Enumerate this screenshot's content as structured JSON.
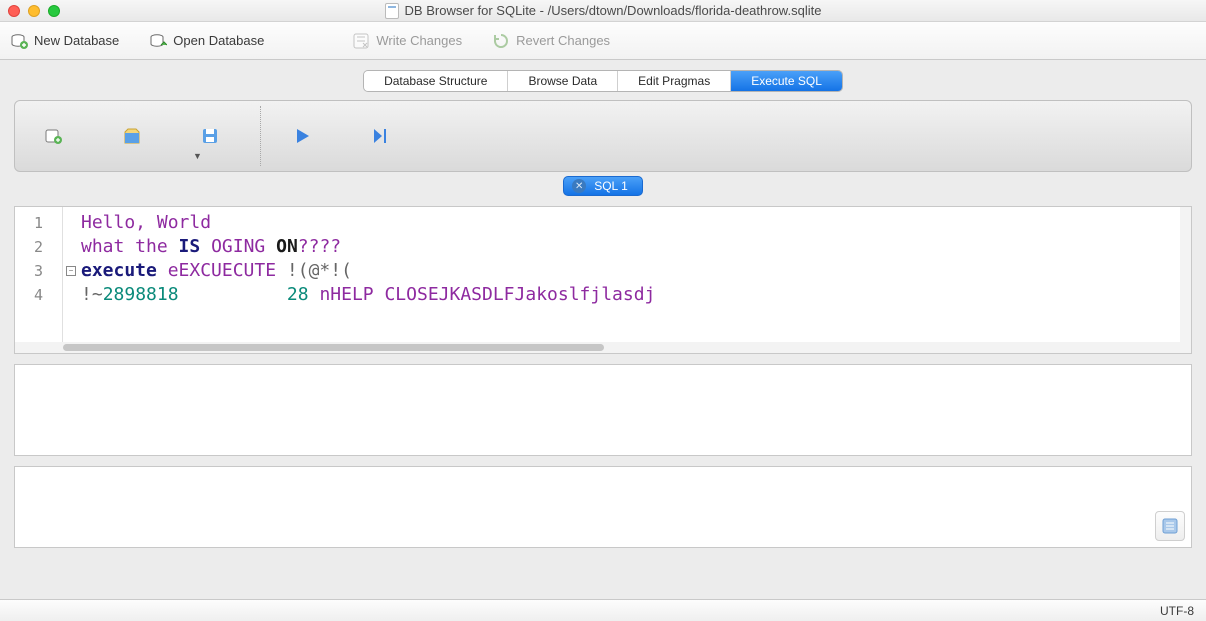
{
  "window": {
    "title": "DB Browser for SQLite - /Users/dtown/Downloads/florida-deathrow.sqlite"
  },
  "toolbar": {
    "new_db": "New Database",
    "open_db": "Open Database",
    "write_changes": "Write Changes",
    "revert_changes": "Revert Changes"
  },
  "tabs": {
    "items": [
      "Database Structure",
      "Browse Data",
      "Edit Pragmas",
      "Execute SQL"
    ],
    "active_index": 3
  },
  "sql_tab": {
    "label": "SQL 1"
  },
  "editor": {
    "lines": [
      {
        "n": 1,
        "tokens": [
          {
            "t": "Hello, World",
            "c": "str"
          }
        ]
      },
      {
        "n": 2,
        "tokens": [
          {
            "t": "what the ",
            "c": "str"
          },
          {
            "t": "IS",
            "c": "kw"
          },
          {
            "t": " ",
            "c": "str"
          },
          {
            "t": "OGING",
            "c": "str"
          },
          {
            "t": " ",
            "c": "str"
          },
          {
            "t": "ON",
            "c": "dark"
          },
          {
            "t": "????",
            "c": "str"
          }
        ]
      },
      {
        "n": 3,
        "fold": true,
        "tokens": [
          {
            "t": "execute",
            "c": "kw"
          },
          {
            "t": " ",
            "c": "str"
          },
          {
            "t": "eEXCUECUTE",
            "c": "str"
          },
          {
            "t": " !(@*!(",
            "c": "sym"
          }
        ]
      },
      {
        "n": 4,
        "tokens": [
          {
            "t": "!~",
            "c": "sym"
          },
          {
            "t": "2898818",
            "c": "num"
          },
          {
            "t": "          ",
            "c": ""
          },
          {
            "t": "28",
            "c": "num"
          },
          {
            "t": " ",
            "c": ""
          },
          {
            "t": "nHELP CLOSEJKASDLFJakoslfjlasdj",
            "c": "str"
          }
        ]
      }
    ]
  },
  "status": {
    "encoding": "UTF-8"
  }
}
